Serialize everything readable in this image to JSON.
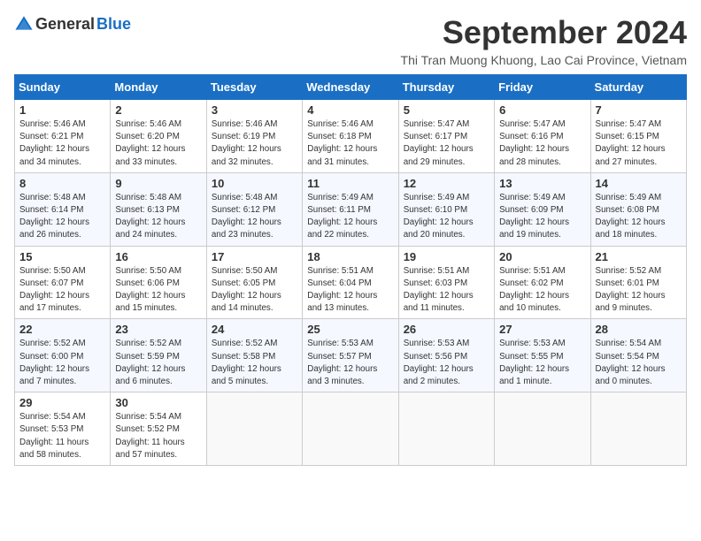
{
  "header": {
    "logo_general": "General",
    "logo_blue": "Blue",
    "month_title": "September 2024",
    "subtitle": "Thi Tran Muong Khuong, Lao Cai Province, Vietnam"
  },
  "days_of_week": [
    "Sunday",
    "Monday",
    "Tuesday",
    "Wednesday",
    "Thursday",
    "Friday",
    "Saturday"
  ],
  "weeks": [
    [
      {
        "day": "1",
        "info": "Sunrise: 5:46 AM\nSunset: 6:21 PM\nDaylight: 12 hours\nand 34 minutes."
      },
      {
        "day": "2",
        "info": "Sunrise: 5:46 AM\nSunset: 6:20 PM\nDaylight: 12 hours\nand 33 minutes."
      },
      {
        "day": "3",
        "info": "Sunrise: 5:46 AM\nSunset: 6:19 PM\nDaylight: 12 hours\nand 32 minutes."
      },
      {
        "day": "4",
        "info": "Sunrise: 5:46 AM\nSunset: 6:18 PM\nDaylight: 12 hours\nand 31 minutes."
      },
      {
        "day": "5",
        "info": "Sunrise: 5:47 AM\nSunset: 6:17 PM\nDaylight: 12 hours\nand 29 minutes."
      },
      {
        "day": "6",
        "info": "Sunrise: 5:47 AM\nSunset: 6:16 PM\nDaylight: 12 hours\nand 28 minutes."
      },
      {
        "day": "7",
        "info": "Sunrise: 5:47 AM\nSunset: 6:15 PM\nDaylight: 12 hours\nand 27 minutes."
      }
    ],
    [
      {
        "day": "8",
        "info": "Sunrise: 5:48 AM\nSunset: 6:14 PM\nDaylight: 12 hours\nand 26 minutes."
      },
      {
        "day": "9",
        "info": "Sunrise: 5:48 AM\nSunset: 6:13 PM\nDaylight: 12 hours\nand 24 minutes."
      },
      {
        "day": "10",
        "info": "Sunrise: 5:48 AM\nSunset: 6:12 PM\nDaylight: 12 hours\nand 23 minutes."
      },
      {
        "day": "11",
        "info": "Sunrise: 5:49 AM\nSunset: 6:11 PM\nDaylight: 12 hours\nand 22 minutes."
      },
      {
        "day": "12",
        "info": "Sunrise: 5:49 AM\nSunset: 6:10 PM\nDaylight: 12 hours\nand 20 minutes."
      },
      {
        "day": "13",
        "info": "Sunrise: 5:49 AM\nSunset: 6:09 PM\nDaylight: 12 hours\nand 19 minutes."
      },
      {
        "day": "14",
        "info": "Sunrise: 5:49 AM\nSunset: 6:08 PM\nDaylight: 12 hours\nand 18 minutes."
      }
    ],
    [
      {
        "day": "15",
        "info": "Sunrise: 5:50 AM\nSunset: 6:07 PM\nDaylight: 12 hours\nand 17 minutes."
      },
      {
        "day": "16",
        "info": "Sunrise: 5:50 AM\nSunset: 6:06 PM\nDaylight: 12 hours\nand 15 minutes."
      },
      {
        "day": "17",
        "info": "Sunrise: 5:50 AM\nSunset: 6:05 PM\nDaylight: 12 hours\nand 14 minutes."
      },
      {
        "day": "18",
        "info": "Sunrise: 5:51 AM\nSunset: 6:04 PM\nDaylight: 12 hours\nand 13 minutes."
      },
      {
        "day": "19",
        "info": "Sunrise: 5:51 AM\nSunset: 6:03 PM\nDaylight: 12 hours\nand 11 minutes."
      },
      {
        "day": "20",
        "info": "Sunrise: 5:51 AM\nSunset: 6:02 PM\nDaylight: 12 hours\nand 10 minutes."
      },
      {
        "day": "21",
        "info": "Sunrise: 5:52 AM\nSunset: 6:01 PM\nDaylight: 12 hours\nand 9 minutes."
      }
    ],
    [
      {
        "day": "22",
        "info": "Sunrise: 5:52 AM\nSunset: 6:00 PM\nDaylight: 12 hours\nand 7 minutes."
      },
      {
        "day": "23",
        "info": "Sunrise: 5:52 AM\nSunset: 5:59 PM\nDaylight: 12 hours\nand 6 minutes."
      },
      {
        "day": "24",
        "info": "Sunrise: 5:52 AM\nSunset: 5:58 PM\nDaylight: 12 hours\nand 5 minutes."
      },
      {
        "day": "25",
        "info": "Sunrise: 5:53 AM\nSunset: 5:57 PM\nDaylight: 12 hours\nand 3 minutes."
      },
      {
        "day": "26",
        "info": "Sunrise: 5:53 AM\nSunset: 5:56 PM\nDaylight: 12 hours\nand 2 minutes."
      },
      {
        "day": "27",
        "info": "Sunrise: 5:53 AM\nSunset: 5:55 PM\nDaylight: 12 hours\nand 1 minute."
      },
      {
        "day": "28",
        "info": "Sunrise: 5:54 AM\nSunset: 5:54 PM\nDaylight: 12 hours\nand 0 minutes."
      }
    ],
    [
      {
        "day": "29",
        "info": "Sunrise: 5:54 AM\nSunset: 5:53 PM\nDaylight: 11 hours\nand 58 minutes."
      },
      {
        "day": "30",
        "info": "Sunrise: 5:54 AM\nSunset: 5:52 PM\nDaylight: 11 hours\nand 57 minutes."
      },
      null,
      null,
      null,
      null,
      null
    ]
  ]
}
